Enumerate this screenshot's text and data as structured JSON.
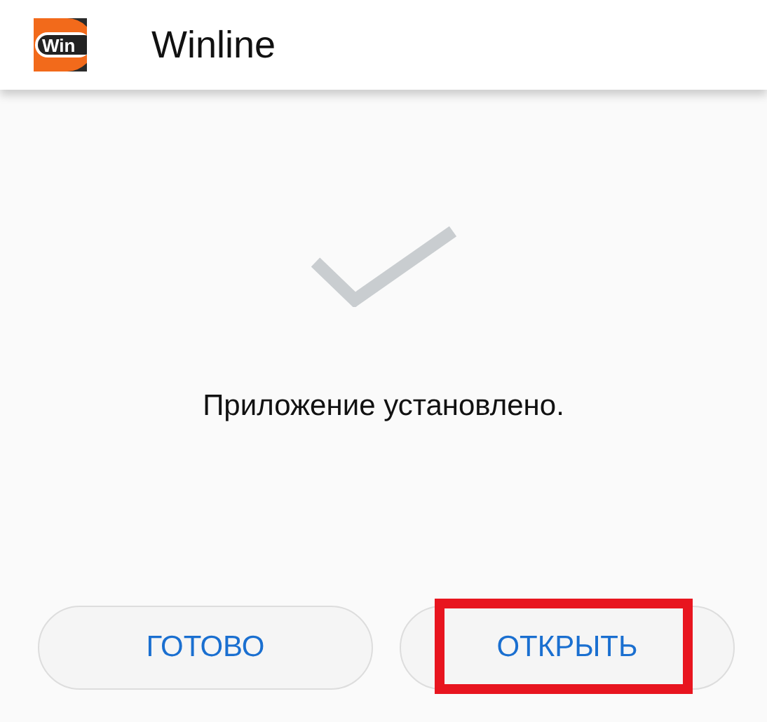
{
  "app_bar": {
    "logo_text": "Win",
    "title": "Winline"
  },
  "status": {
    "message": "Приложение установлено."
  },
  "buttons": [
    {
      "label": "ГОТОВО",
      "highlighted": false
    },
    {
      "label": "ОТКРЫТЬ",
      "highlighted": true
    }
  ]
}
